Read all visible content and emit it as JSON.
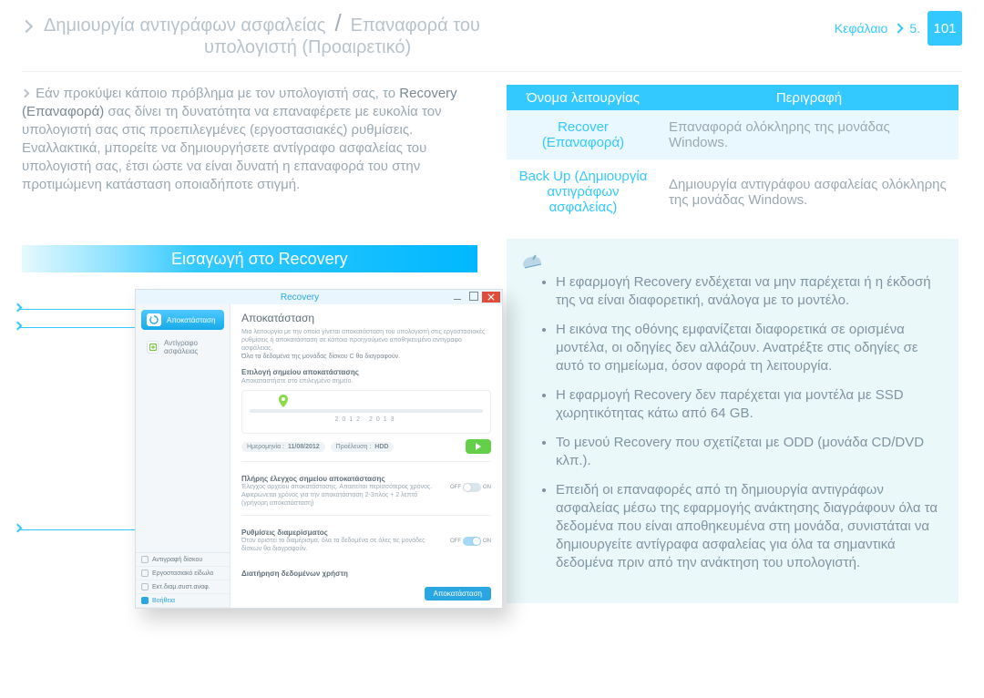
{
  "header": {
    "chapter_label": "Κεφάλαιο",
    "chapter_num": "5.",
    "page_num": "101",
    "line1_pre": "Δημιουργία αντιγράφων ασφαλείας",
    "line1_slash": "/",
    "line1_post": "Επαναφορά του",
    "line2": "υπολογιστή (Προαιρετικό)"
  },
  "intro": {
    "p1_a": "Εάν προκύψει κάποιο πρόβλημα με τον υπολογιστή σας, το ",
    "p1_b": "Recovery (Επαναφορά)",
    "p1_c": " σας δίνει τη δυνατότητα να επαναφέρετε με ευκολία τον υπολογιστή σας στις προεπιλεγμένες (εργοστασιακές) ρυθμίσεις. Εναλλακτικά, μπορείτε να δημιουργήσετε αντίγραφο ασφαλείας του υπολογιστή σας, έτσι ώστε να είναι δυνατή η επαναφορά του στην προτιμώμενη κατάσταση οποιαδήποτε στιγμή."
  },
  "section_heading": "Εισαγωγή στο Recovery",
  "screenshot": {
    "title": "Recovery",
    "nav_main": "Αποκατάσταση",
    "nav_backup": "Αντίγραφο ασφάλειας",
    "bottom1": "Αντιγραφή δίσκου",
    "bottom2": "Εργοστασιακό είδωλο",
    "bottom3": "Εκτ.διαμ.συστ.αναφ.",
    "bottom4": "Βοήθεια",
    "main_title": "Αποκατάσταση",
    "main_desc1": "Μια λειτουργία με την οποία γίνεται αποκατάσταση του υπολογιστή στις εργοστασιακές ρυθμίσεις ή αποκατάσταση σε κάποιο προηγούμενο αποθηκευμένο αντίγραφο ασφάλειας.",
    "main_desc2": "Όλα τα δεδομένα της μονάδας δίσκου C θα διαγραφούν.",
    "sub1_title": "Επιλογή σημείου αποκατάστασης",
    "sub1_desc": "Αποκαταστήστε στο επιλεγμένο σημείο.",
    "timeline_years": "2012               2013",
    "pill_date_label": "Ημερομηνία :",
    "pill_date_val": "11/08/2012",
    "pill_loc_label": "Προέλευση :",
    "pill_loc_val": "HDD",
    "sub2_title": "Πλήρης έλεγχος σημείου αποκατάστασης",
    "sub2_desc": "Έλεγχος αρχείου αποκατάστασης. Απαιτείται περισσότερος χρόνος. Αφιερώνεται χρόνος για την αποκατάσταση 2-3πλός + 2 λεπτά (γρήγορη αποκατάσταση)",
    "toggle_off": "OFF",
    "toggle_on": "ON",
    "sub3_title": "Ρυθμίσεις διαμερίσματος",
    "sub3_desc": "Όταν οριστεί το διαμέρισμα, όλα τα δεδομένα σε όλες τις μονάδες δίσκων θα διαγραφούν.",
    "sub4_title": "Διατήρηση δεδομένων χρήστη",
    "restore_btn": "Αποκατάσταση",
    "callout_labels": {
      "recover_tab": "Αποκατάσταση",
      "backup_tab": "Αντίγραφο ασφάλειας",
      "help": "Βοήθεια"
    }
  },
  "table": {
    "head_name": "Όνομα λειτουργίας",
    "head_desc": "Περιγραφή",
    "rows": [
      {
        "name": "Recover (Επαναφορά)",
        "desc": "Επαναφορά ολόκληρης της μονάδας Windows."
      },
      {
        "name": "Back Up (Δημιουργία αντιγράφων ασφαλείας)",
        "desc": "Δημιουργία αντιγράφου ασφαλείας ολόκληρης της μονάδας Windows."
      }
    ]
  },
  "notes": {
    "items": [
      "Η εφαρμογή Recovery ενδέχεται να μην παρέχεται ή η έκδοσή της να είναι διαφορετική, ανάλογα με το μοντέλο.",
      "Η εικόνα της οθόνης εμφανίζεται διαφορετικά σε ορισμένα μοντέλα, οι οδηγίες δεν αλλάζουν. Ανατρέξτε στις οδηγίες σε αυτό το σημείωμα, όσον αφορά τη λειτουργία.",
      "Η εφαρμογή Recovery δεν παρέχεται για μοντέλα με SSD χωρητικότητας κάτω από 64 GB.",
      "Το μενού Recovery που σχετίζεται με ODD (μονάδα CD/DVD κλπ.).",
      "Επειδή οι επαναφορές από τη δημιουργία αντιγράφων ασφαλείας μέσω της εφαρμογής ανάκτησης διαγράφουν όλα τα δεδομένα που είναι αποθηκευμένα στη μονάδα, συνιστάται να δημιουργείτε αντίγραφα ασφαλείας για όλα τα σημαντικά δεδομένα πριν από την ανάκτηση του υπολογιστή."
    ],
    "r_terms": {
      "recovery": "Recovery",
      "ssd": "SSD",
      "gb": "64 GB",
      "odd": "ODD",
      "cddvd": "CD/DVD"
    }
  }
}
